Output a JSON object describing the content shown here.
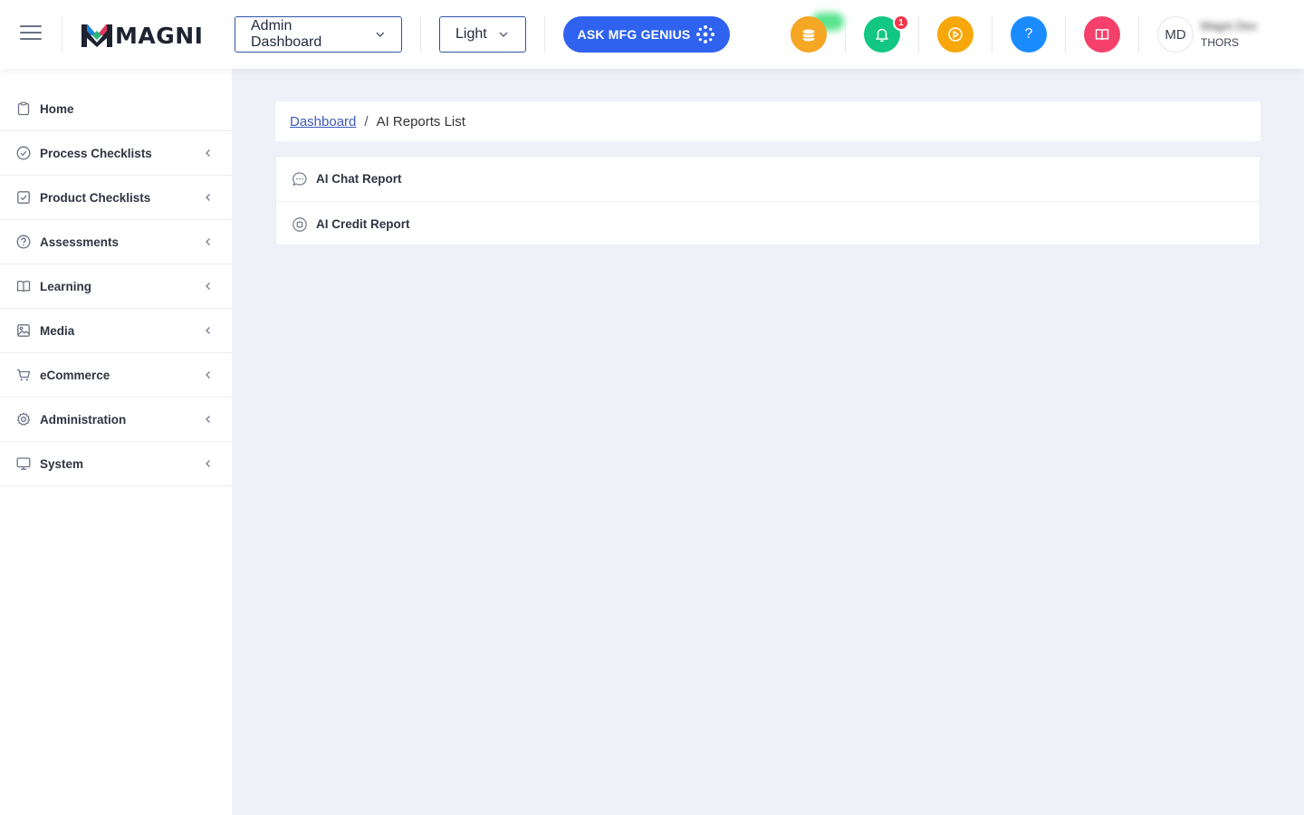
{
  "header": {
    "logo_text": "MAGNI",
    "dashboard_select": {
      "value": "Admin Dashboard"
    },
    "theme_select": {
      "value": "Light"
    },
    "ask_button_label": "ASK MFG GENIUS",
    "notification_count": "1",
    "help_label": "?",
    "user": {
      "initials": "MD",
      "name": "Magni Dev",
      "org": "THORS"
    },
    "colors": {
      "ask_button": "#2f62ee",
      "credits": "#f5a623",
      "notifications": "#12c781",
      "video": "#f7a70a",
      "help": "#1a8cff",
      "guide": "#f4406b",
      "badge": "#f4364c"
    }
  },
  "sidebar": {
    "items": [
      {
        "label": "Home",
        "icon": "clipboard-icon"
      },
      {
        "label": "Process Checklists",
        "icon": "check-circle-icon"
      },
      {
        "label": "Product Checklists",
        "icon": "check-square-icon"
      },
      {
        "label": "Assessments",
        "icon": "question-circle-icon"
      },
      {
        "label": "Learning",
        "icon": "book-open-icon"
      },
      {
        "label": "Media",
        "icon": "image-icon"
      },
      {
        "label": "eCommerce",
        "icon": "cart-icon"
      },
      {
        "label": "Administration",
        "icon": "gear-icon"
      },
      {
        "label": "System",
        "icon": "monitor-icon"
      }
    ]
  },
  "breadcrumb": {
    "root": "Dashboard",
    "separator": "/",
    "current": "AI Reports List"
  },
  "reports": {
    "items": [
      {
        "label": "AI Chat Report",
        "icon": "chat-bubble-icon"
      },
      {
        "label": "AI Credit Report",
        "icon": "credit-circle-icon"
      }
    ]
  }
}
